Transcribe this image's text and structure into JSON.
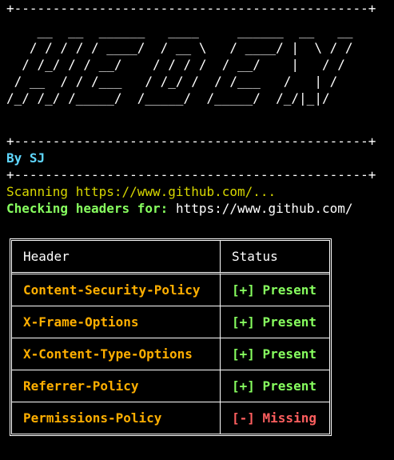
{
  "banner": {
    "border_top": "+----------------------------------------------+",
    "art_lines": [
      "    __  __  ______   ____     ______  __   __",
      "   / / / / / ____/  / __ \\   / ____/ |  \\ / /",
      "  / /_/ / / __/    / / / /  / __/    |   / /",
      " / __  / / /___   / /_/ /  / /___   /   | /",
      "/_/ /_/ /_____/  /_____/  /_____/  /_/|_|/"
    ],
    "border_mid": "+----------------------------------------------+",
    "byline": "By SJ",
    "border_bottom": "+----------------------------------------------+"
  },
  "scan": {
    "scanning_text": "Scanning https://www.github.com/...",
    "checking_label": "Checking headers for:",
    "checking_url": "https://www.github.com/"
  },
  "table": {
    "columns": [
      "Header",
      "Status"
    ],
    "rows": [
      {
        "header": "Content-Security-Policy",
        "status": "[+] Present",
        "ok": true
      },
      {
        "header": "X-Frame-Options",
        "status": "[+] Present",
        "ok": true
      },
      {
        "header": "X-Content-Type-Options",
        "status": "[+] Present",
        "ok": true
      },
      {
        "header": "Referrer-Policy",
        "status": "[+] Present",
        "ok": true
      },
      {
        "header": "Permissions-Policy",
        "status": "[-] Missing",
        "ok": false
      }
    ]
  },
  "colors": {
    "background": "#000000",
    "byline": "#5fd7ff",
    "scanning": "#d7d700",
    "checking_label": "#87ff5f",
    "header_name": "#ffaf00",
    "present": "#87ff5f",
    "missing": "#ff5f5f"
  }
}
